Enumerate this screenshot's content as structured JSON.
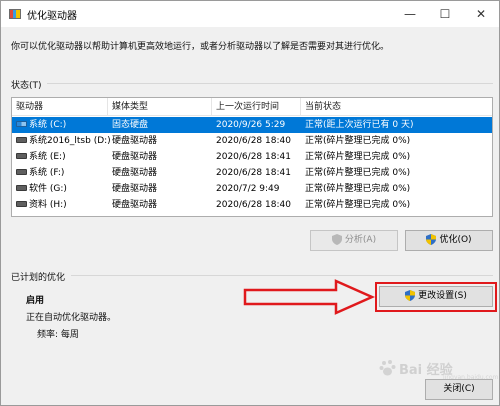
{
  "window": {
    "title": "优化驱动器",
    "minimize_glyph": "—",
    "maximize_glyph": "☐",
    "close_glyph": "✕"
  },
  "description": "你可以优化驱动器以帮助计算机更高效地运行，或者分析驱动器以了解是否需要对其进行优化。",
  "status_section": {
    "label": "状态(T)",
    "columns": [
      "驱动器",
      "媒体类型",
      "上一次运行时间",
      "当前状态"
    ],
    "rows": [
      {
        "drive": "系统 (C:)",
        "type": "固态硬盘",
        "time": "2020/9/26 5:29",
        "status": "正常(距上次运行已有 0 天)",
        "icon": "windows-drive-icon",
        "selected": true
      },
      {
        "drive": "系统2016_ltsb (D:)",
        "type": "硬盘驱动器",
        "time": "2020/6/28 18:40",
        "status": "正常(碎片整理已完成 0%)",
        "icon": "drive-icon"
      },
      {
        "drive": "系统 (E:)",
        "type": "硬盘驱动器",
        "time": "2020/6/28 18:41",
        "status": "正常(碎片整理已完成 0%)",
        "icon": "drive-icon"
      },
      {
        "drive": "系统 (F:)",
        "type": "硬盘驱动器",
        "time": "2020/6/28 18:41",
        "status": "正常(碎片整理已完成 0%)",
        "icon": "drive-icon"
      },
      {
        "drive": "软件 (G:)",
        "type": "硬盘驱动器",
        "time": "2020/7/2 9:49",
        "status": "正常(碎片整理已完成 0%)",
        "icon": "drive-icon"
      },
      {
        "drive": "资料 (H:)",
        "type": "硬盘驱动器",
        "time": "2020/6/28 18:40",
        "status": "正常(碎片整理已完成 0%)",
        "icon": "drive-icon"
      }
    ],
    "analyze_label": "分析(A)",
    "optimize_label": "优化(O)"
  },
  "scheduled_section": {
    "label": "已计划的优化",
    "status": "启用",
    "detail": "正在自动优化驱动器。",
    "frequency": "频率: 每周",
    "change_settings_label": "更改设置(S)"
  },
  "close_label": "关闭(C)",
  "watermark": {
    "text": "Bai 经验",
    "sub": "jingyan.baidu.com"
  },
  "colors": {
    "selection": "#0078d7",
    "annotation_red": "#e0191c",
    "shield_blue": "#2f6fc6",
    "shield_yellow": "#f2c200"
  }
}
